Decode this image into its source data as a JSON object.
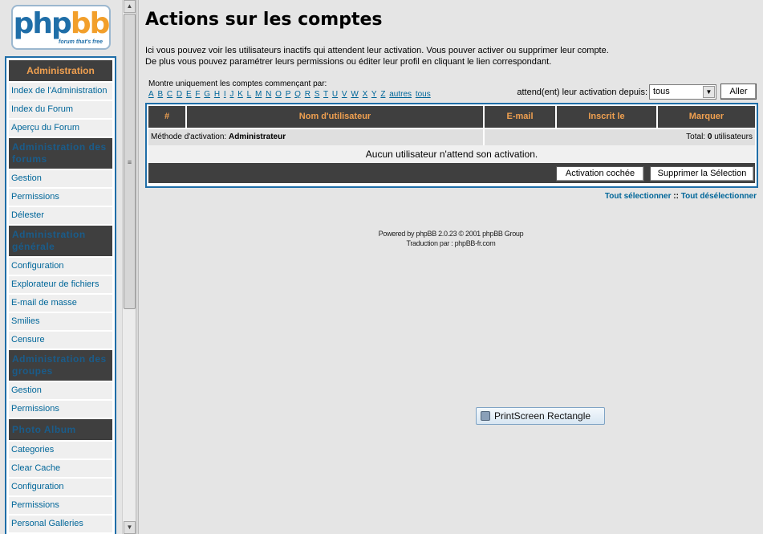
{
  "logo": {
    "word_a": "php",
    "word_b": "bb",
    "tagline": "forum that's free"
  },
  "nav": {
    "title": "Administration",
    "blocks": [
      {
        "items": [
          "Index de l'Administration",
          "Index du Forum",
          "Aperçu du Forum"
        ]
      },
      {
        "section": "Administration des forums",
        "items": [
          "Gestion",
          "Permissions",
          "Délester"
        ]
      },
      {
        "section": "Administration générale",
        "items": [
          "Configuration",
          "Explorateur de fichiers",
          "E-mail de masse",
          "Smilies",
          "Censure"
        ]
      },
      {
        "section": "Administration des groupes",
        "items": [
          "Gestion",
          "Permissions"
        ]
      },
      {
        "section": "Photo Album",
        "items": [
          "Categories",
          "Clear Cache",
          "Configuration",
          "Permissions",
          "Personal Galleries"
        ]
      }
    ]
  },
  "scrollbar": {
    "grip": "≡",
    "up": "▲",
    "down": "▼"
  },
  "main": {
    "title": "Actions sur les comptes",
    "intro_line1": "Ici vous pouvez voir les utilisateurs inactifs qui attendent leur activation. Vous pouver activer ou supprimer leur compte.",
    "intro_line2": "De plus vous pouvez paramétrer leurs permissions ou éditer leur profil en cliquant le lien correspondant.",
    "filter_label": "Montre uniquement les comptes commençant par:",
    "letters": [
      "A",
      "B",
      "C",
      "D",
      "E",
      "F",
      "G",
      "H",
      "I",
      "J",
      "K",
      "L",
      "M",
      "N",
      "O",
      "P",
      "Q",
      "R",
      "S",
      "T",
      "U",
      "V",
      "W",
      "X",
      "Y",
      "Z",
      "autres",
      "tous"
    ],
    "since_label": "attend(ent) leur activation depuis:",
    "since_value": "tous",
    "go_label": "Aller",
    "table": {
      "headers": [
        "#",
        "Nom d'utilisateur",
        "E-mail",
        "Inscrit le",
        "Marquer"
      ],
      "method_prefix": "Méthode d'activation: ",
      "method_value": "Administrateur",
      "total_prefix": "Total: ",
      "total_value": "0",
      "total_suffix": " utilisateurs",
      "empty_message": "Aucun utilisateur n'attend son activation.",
      "activate_label": "Activation cochée",
      "delete_label": "Supprimer la Sélection"
    },
    "select_all": "Tout sélectionner",
    "select_sep": " :: ",
    "deselect_all": "Tout désélectionner",
    "footer_line1": "Powered by phpBB 2.0.23 © 2001 phpBB Group",
    "footer_line2": "Traduction par : phpBB-fr.com"
  },
  "overlay": {
    "printscreen_label": "PrintScreen Rectangle"
  }
}
